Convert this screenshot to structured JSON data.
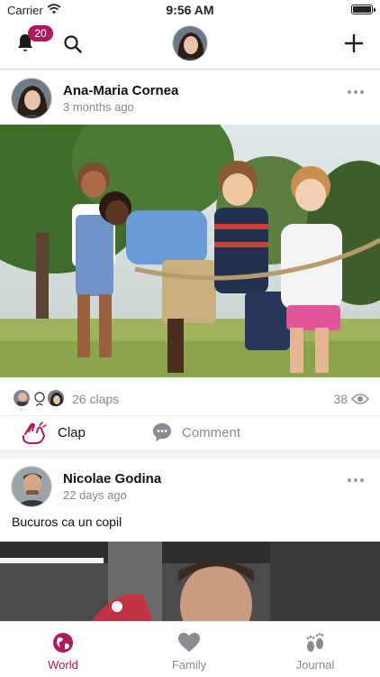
{
  "status_bar": {
    "carrier": "Carrier",
    "time": "9:56 AM"
  },
  "top_bar": {
    "notification_count": "20"
  },
  "posts": [
    {
      "author": "Ana-Maria Cornea",
      "time": "3 months ago",
      "claps": "26 claps",
      "views": "38",
      "clap_label": "Clap",
      "comment_label": "Comment"
    },
    {
      "author": "Nicolae Godina",
      "time": "22 days ago",
      "caption": "Bucuros ca un copil"
    }
  ],
  "tabs": [
    {
      "label": "World",
      "active": true
    },
    {
      "label": "Family",
      "active": false
    },
    {
      "label": "Journal",
      "active": false
    }
  ],
  "colors": {
    "accent": "#b0185f",
    "muted": "#8a8a90"
  },
  "icons": [
    "bell-icon",
    "search-icon",
    "plus-icon",
    "more-icon",
    "eye-icon",
    "clap-icon",
    "comment-icon",
    "world-icon",
    "heart-icon",
    "footprints-icon"
  ]
}
